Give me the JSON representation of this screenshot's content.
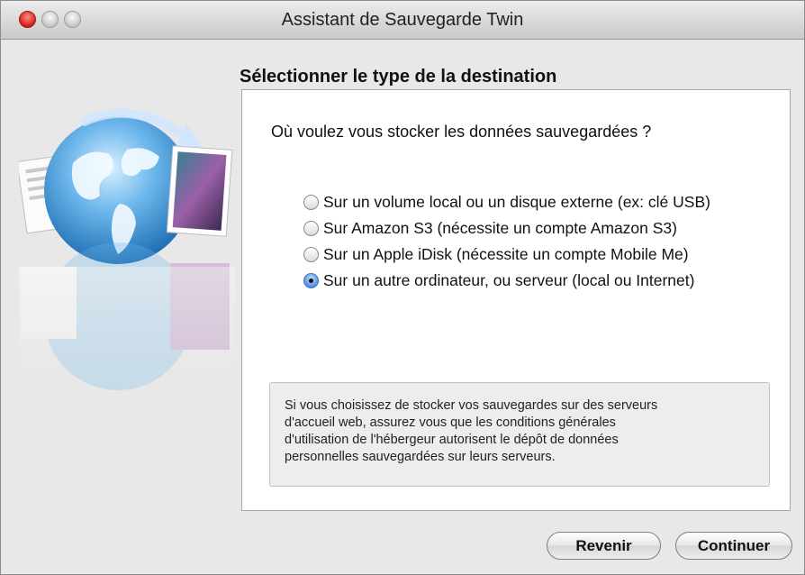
{
  "window": {
    "title": "Assistant de Sauvegarde Twin"
  },
  "main": {
    "heading": "Sélectionner le type de la destination",
    "question": "Où voulez vous stocker les données sauvegardées ?",
    "options": [
      {
        "label": "Sur un volume local ou un disque externe (ex: clé USB)",
        "selected": false
      },
      {
        "label": "Sur Amazon S3 (nécessite un compte Amazon S3)",
        "selected": false
      },
      {
        "label": "Sur un Apple iDisk (nécessite un compte Mobile Me)",
        "selected": false
      },
      {
        "label": "Sur un autre ordinateur, ou serveur (local ou Internet)",
        "selected": true
      }
    ],
    "notice_lines": [
      "Si vous choisissez de stocker vos sauvegardes sur des serveurs",
      "d'accueil web, assurez vous que les conditions générales",
      "d'utilisation de l'hébergeur autorisent le dépôt de données",
      "personnelles sauvegardées sur leurs serveurs."
    ]
  },
  "footer": {
    "back_label": "Revenir",
    "continue_label": "Continuer"
  },
  "icons": {
    "app_illustration": "globe-with-documents-icon"
  },
  "colors": {
    "window_background": "#e8e8e8",
    "close_button": "#d0201a",
    "selected_radio": "#4f8ee0"
  }
}
